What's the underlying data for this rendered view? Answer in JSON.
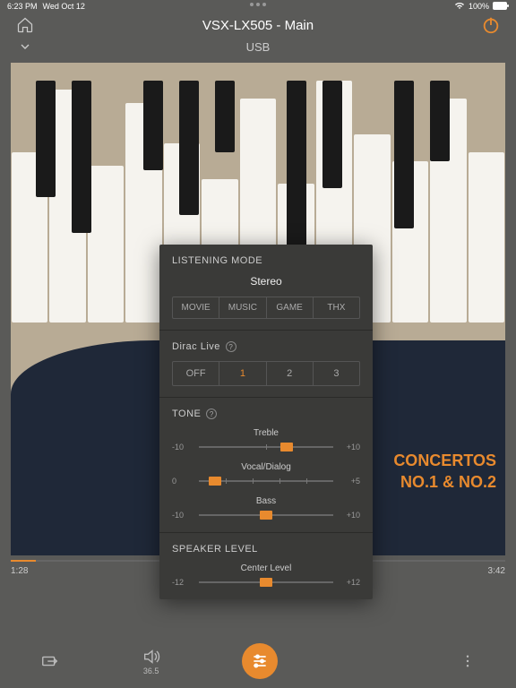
{
  "status": {
    "time": "6:23 PM",
    "date": "Wed Oct 12",
    "wifi": "wifi-icon",
    "battery_pct": "100%"
  },
  "header": {
    "title": "VSX-LX505 - Main",
    "subtitle": "USB"
  },
  "album": {
    "line1": "CONCERTOS",
    "line2": "NO.1 & NO.2"
  },
  "playback": {
    "elapsed": "1:28",
    "total": "3:42"
  },
  "bottom": {
    "volume_value": "36.5"
  },
  "panel": {
    "listening": {
      "title": "LISTENING MODE",
      "current": "Stereo",
      "tabs": [
        "MOVIE",
        "MUSIC",
        "GAME",
        "THX"
      ]
    },
    "dirac": {
      "title": "Dirac Live",
      "options": [
        "OFF",
        "1",
        "2",
        "3"
      ],
      "active_index": 1
    },
    "tone": {
      "title": "TONE",
      "sliders": [
        {
          "label": "Treble",
          "min": "-10",
          "max": "+10",
          "pos": 65
        },
        {
          "label": "Vocal/Dialog",
          "min": "0",
          "max": "+5",
          "pos": 12
        },
        {
          "label": "Bass",
          "min": "-10",
          "max": "+10",
          "pos": 50
        }
      ]
    },
    "speaker": {
      "title": "SPEAKER LEVEL",
      "slider": {
        "label": "Center Level",
        "min": "-12",
        "max": "+12",
        "pos": 50
      }
    }
  }
}
